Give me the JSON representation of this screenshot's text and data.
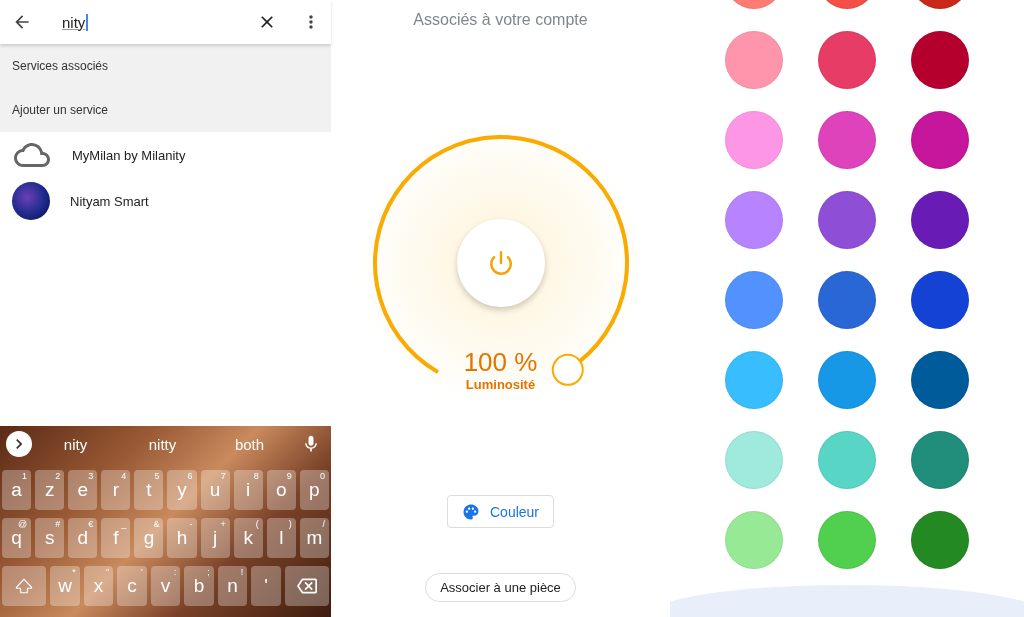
{
  "search_panel": {
    "query": "nity",
    "sections": [
      "Services associés",
      "Ajouter un service"
    ],
    "results": [
      {
        "name": "MyMilan by Milanity",
        "kind": "cloud"
      },
      {
        "name": "Nityam Smart",
        "kind": "logo"
      }
    ]
  },
  "keyboard": {
    "suggestions": [
      "nity",
      "nitty",
      "both"
    ],
    "rows": [
      [
        {
          "kind": "letter",
          "key": "a",
          "hint": "1"
        },
        {
          "kind": "letter",
          "key": "z",
          "hint": "2"
        },
        {
          "kind": "letter",
          "key": "e",
          "hint": "3"
        },
        {
          "kind": "letter",
          "key": "r",
          "hint": "4"
        },
        {
          "kind": "letter",
          "key": "t",
          "hint": "5"
        },
        {
          "kind": "letter",
          "key": "y",
          "hint": "6"
        },
        {
          "kind": "letter",
          "key": "u",
          "hint": "7"
        },
        {
          "kind": "letter",
          "key": "i",
          "hint": "8"
        },
        {
          "kind": "letter",
          "key": "o",
          "hint": "9"
        },
        {
          "kind": "letter",
          "key": "p",
          "hint": "0"
        }
      ],
      [
        {
          "kind": "letter",
          "key": "q",
          "hint": "@"
        },
        {
          "kind": "letter",
          "key": "s",
          "hint": "#"
        },
        {
          "kind": "letter",
          "key": "d",
          "hint": "€"
        },
        {
          "kind": "letter",
          "key": "f",
          "hint": "_"
        },
        {
          "kind": "letter",
          "key": "g",
          "hint": "&"
        },
        {
          "kind": "letter",
          "key": "h",
          "hint": "-"
        },
        {
          "kind": "letter",
          "key": "j",
          "hint": "+"
        },
        {
          "kind": "letter",
          "key": "k",
          "hint": "("
        },
        {
          "kind": "letter",
          "key": "l",
          "hint": ")"
        },
        {
          "kind": "letter",
          "key": "m",
          "hint": "/"
        }
      ],
      [
        {
          "kind": "shift"
        },
        {
          "kind": "letter",
          "key": "w",
          "hint": "*"
        },
        {
          "kind": "letter",
          "key": "x",
          "hint": "\""
        },
        {
          "kind": "letter",
          "key": "c",
          "hint": "'"
        },
        {
          "kind": "letter",
          "key": "v",
          "hint": ":"
        },
        {
          "kind": "letter",
          "key": "b",
          "hint": ";"
        },
        {
          "kind": "letter",
          "key": "n",
          "hint": "!"
        },
        {
          "kind": "letter",
          "key": "'"
        },
        {
          "kind": "backspace"
        }
      ]
    ]
  },
  "light": {
    "title": "Associés à votre compte",
    "on": true,
    "brightness": {
      "level": 1,
      "reading": "100 %",
      "label": "Luminosité"
    },
    "color_button": "Couleur",
    "room_button": "Associer à une pièce"
  },
  "palette": {
    "swatches": [
      {
        "color": "#ff7b73"
      },
      {
        "color": "#f44f48"
      },
      {
        "color": "#c9281c"
      },
      {
        "color": "#ff95ad"
      },
      {
        "color": "#e63c66"
      },
      {
        "color": "#b5002e"
      },
      {
        "color": "#fd97e5"
      },
      {
        "color": "#df43bb"
      },
      {
        "color": "#c5169c"
      },
      {
        "color": "#b883ff"
      },
      {
        "color": "#8f4ed6"
      },
      {
        "color": "#691bb6"
      },
      {
        "color": "#5292ff"
      },
      {
        "color": "#2967d6"
      },
      {
        "color": "#1442d4"
      },
      {
        "color": "#38bdfe"
      },
      {
        "color": "#1798e6"
      },
      {
        "color": "#005b9b"
      },
      {
        "color": "#9fe9dd"
      },
      {
        "color": "#58d5c4"
      },
      {
        "color": "#218d7b"
      },
      {
        "color": "#98e996"
      },
      {
        "color": "#51cf4f"
      },
      {
        "color": "#238a23"
      }
    ]
  }
}
